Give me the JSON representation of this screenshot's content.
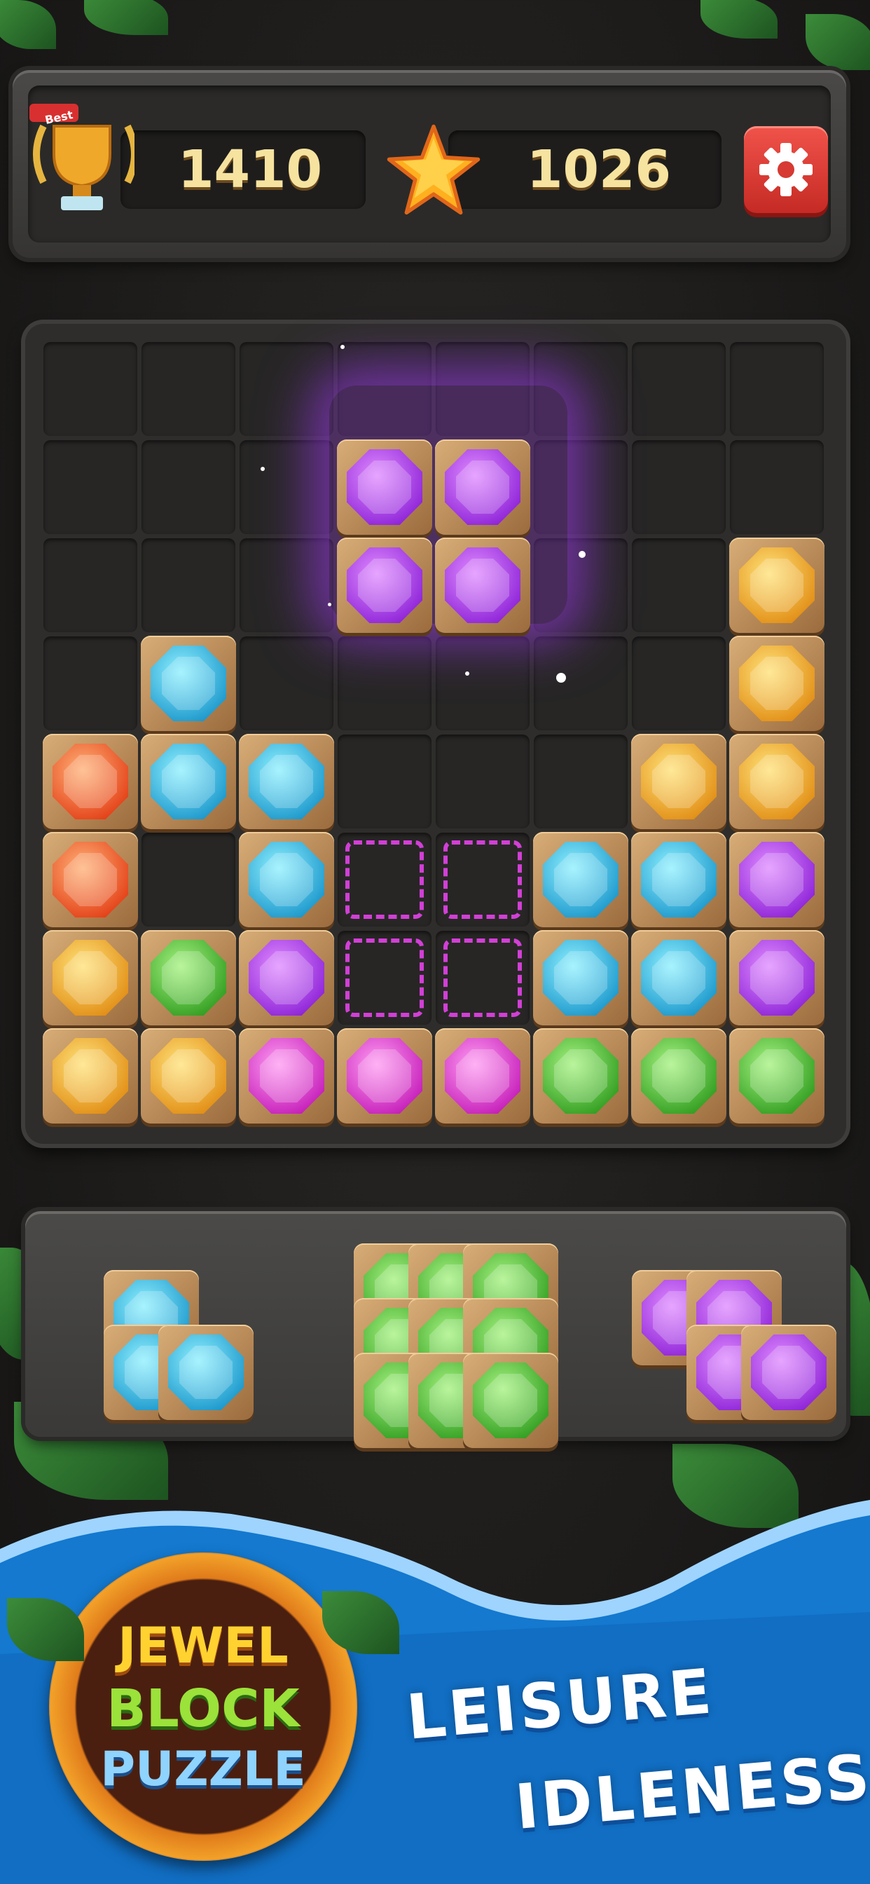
{
  "hud": {
    "best_score": "1410",
    "current_score": "1026",
    "best_badge": "Best",
    "trophy_icon": "trophy-icon",
    "star_icon": "star-icon",
    "settings_icon": "gear-icon"
  },
  "colors": {
    "purple": [
      "#e08bff",
      "#8a1fd6"
    ],
    "cyan": [
      "#8ff0ff",
      "#1693c9"
    ],
    "orange": [
      "#ffb278",
      "#e23a12"
    ],
    "yellow": [
      "#ffe27a",
      "#e08a10"
    ],
    "green": [
      "#a6f280",
      "#2c9a1c"
    ],
    "pink": [
      "#ff9cf2",
      "#c218b6"
    ]
  },
  "board": {
    "rows": 8,
    "cols": 8,
    "tiles": [
      {
        "r": 1,
        "c": 3,
        "color": "purple"
      },
      {
        "r": 1,
        "c": 4,
        "color": "purple"
      },
      {
        "r": 2,
        "c": 3,
        "color": "purple"
      },
      {
        "r": 2,
        "c": 4,
        "color": "purple"
      },
      {
        "r": 2,
        "c": 7,
        "color": "yellow"
      },
      {
        "r": 3,
        "c": 1,
        "color": "cyan"
      },
      {
        "r": 3,
        "c": 7,
        "color": "yellow"
      },
      {
        "r": 4,
        "c": 0,
        "color": "orange"
      },
      {
        "r": 4,
        "c": 1,
        "color": "cyan"
      },
      {
        "r": 4,
        "c": 2,
        "color": "cyan"
      },
      {
        "r": 4,
        "c": 6,
        "color": "yellow"
      },
      {
        "r": 4,
        "c": 7,
        "color": "yellow"
      },
      {
        "r": 5,
        "c": 0,
        "color": "orange"
      },
      {
        "r": 5,
        "c": 2,
        "color": "cyan"
      },
      {
        "r": 5,
        "c": 5,
        "color": "cyan"
      },
      {
        "r": 5,
        "c": 6,
        "color": "cyan"
      },
      {
        "r": 5,
        "c": 7,
        "color": "purple"
      },
      {
        "r": 6,
        "c": 0,
        "color": "yellow"
      },
      {
        "r": 6,
        "c": 1,
        "color": "green"
      },
      {
        "r": 6,
        "c": 2,
        "color": "purple"
      },
      {
        "r": 6,
        "c": 5,
        "color": "cyan"
      },
      {
        "r": 6,
        "c": 6,
        "color": "cyan"
      },
      {
        "r": 6,
        "c": 7,
        "color": "purple"
      },
      {
        "r": 7,
        "c": 0,
        "color": "yellow"
      },
      {
        "r": 7,
        "c": 1,
        "color": "yellow"
      },
      {
        "r": 7,
        "c": 2,
        "color": "pink"
      },
      {
        "r": 7,
        "c": 3,
        "color": "pink"
      },
      {
        "r": 7,
        "c": 4,
        "color": "pink"
      },
      {
        "r": 7,
        "c": 5,
        "color": "green"
      },
      {
        "r": 7,
        "c": 6,
        "color": "green"
      },
      {
        "r": 7,
        "c": 7,
        "color": "green"
      }
    ],
    "targets": [
      {
        "r": 5,
        "c": 3
      },
      {
        "r": 5,
        "c": 4
      },
      {
        "r": 6,
        "c": 3
      },
      {
        "r": 6,
        "c": 4
      }
    ]
  },
  "tray": {
    "pieces": [
      {
        "name": "piece-l-cyan",
        "color": "cyan",
        "cells": [
          [
            0,
            0
          ],
          [
            1,
            0
          ],
          [
            1,
            1
          ]
        ]
      },
      {
        "name": "piece-square-green",
        "color": "green",
        "cells": [
          [
            0,
            0
          ],
          [
            0,
            1
          ],
          [
            0,
            2
          ],
          [
            1,
            0
          ],
          [
            1,
            1
          ],
          [
            1,
            2
          ],
          [
            2,
            0
          ],
          [
            2,
            1
          ],
          [
            2,
            2
          ]
        ]
      },
      {
        "name": "piece-z-purple",
        "color": "purple",
        "cells": [
          [
            0,
            0
          ],
          [
            0,
            1
          ],
          [
            1,
            1
          ],
          [
            1,
            2
          ]
        ]
      }
    ]
  },
  "banner": {
    "logo": [
      "JEWEL",
      "BLOCK",
      "PUZZLE"
    ],
    "tagline_1": "LEISURE",
    "tagline_2": "IDLENESS"
  }
}
